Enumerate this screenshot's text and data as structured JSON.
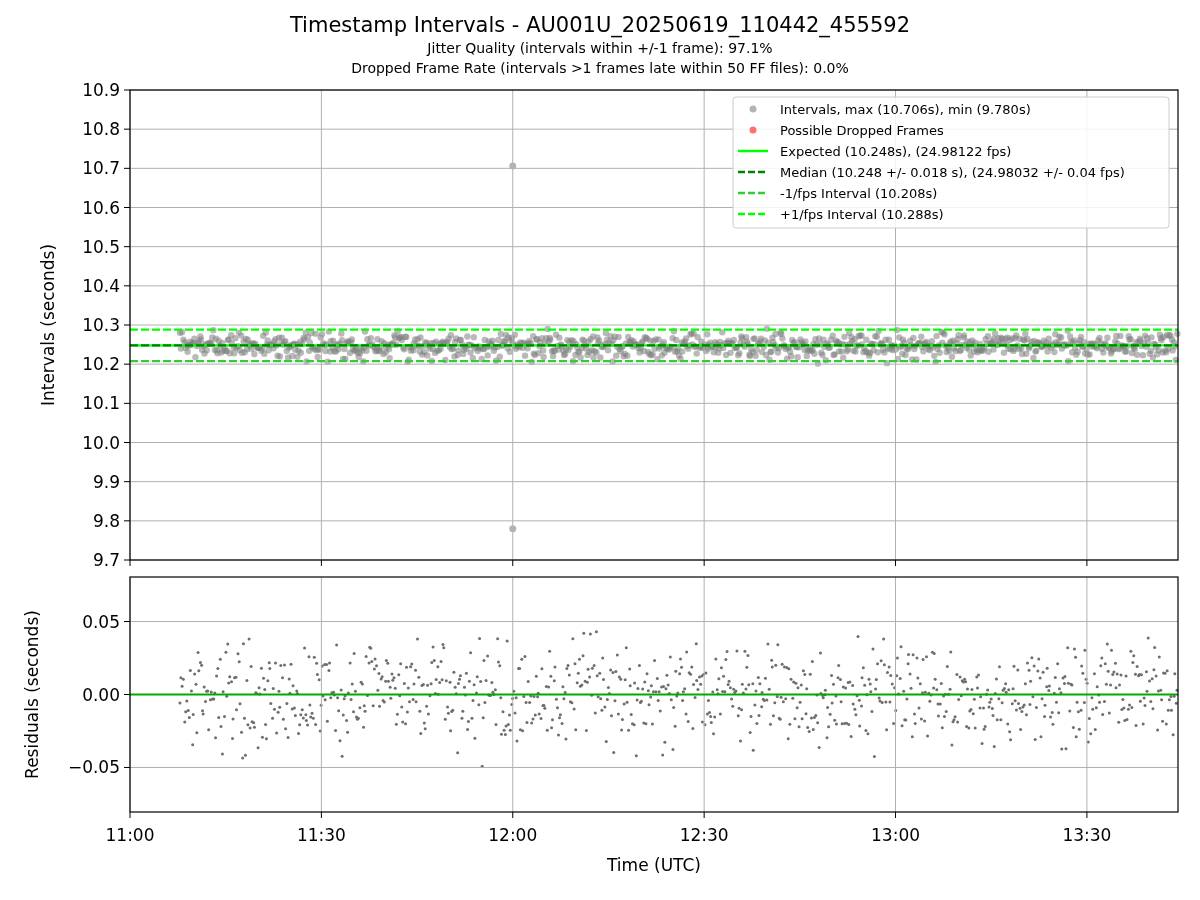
{
  "title": "Timestamp Intervals - AU001U_20250619_110442_455592",
  "subtitles": [
    "Jitter Quality (intervals within +/-1 frame): 97.1%",
    "Dropped Frame Rate (intervals >1 frames late within 50 FF files): 0.0%"
  ],
  "charts": [
    {
      "chart_data": {
        "type": "scatter",
        "ylabel": "Intervals (seconds)",
        "grid": true,
        "legend": "upper right",
        "x": [
          12,
          12
        ],
        "xlim": [
          11,
          13.738
        ],
        "ylim": [
          9.7,
          10.9
        ],
        "yticks": [
          {
            "value": 9.7,
            "label": "9.7"
          },
          {
            "value": 9.8,
            "label": "9.8"
          },
          {
            "value": 9.9,
            "label": "9.9"
          },
          {
            "value": 10.0,
            "label": "10.0"
          },
          {
            "value": 10.1,
            "label": "10.1"
          },
          {
            "value": 10.2,
            "label": "10.2"
          },
          {
            "value": 10.3,
            "label": "10.3"
          },
          {
            "value": 10.4,
            "label": "10.4"
          },
          {
            "value": 10.5,
            "label": "10.5"
          },
          {
            "value": 10.6,
            "label": "10.6"
          },
          {
            "value": 10.7,
            "label": "10.7"
          },
          {
            "value": 10.8,
            "label": "10.8"
          },
          {
            "value": 10.9,
            "label": "10.9"
          }
        ],
        "series": [
          {
            "name": "Intervals, max (10.706s), min (9.780s)",
            "color": "#b3b3b3",
            "values": [
              10.706,
              9.78
            ]
          },
          {
            "name": "Possible Dropped Frames",
            "color": "#ff7070",
            "values": [
              null,
              null
            ]
          }
        ],
        "ref_lines": [
          {
            "axis": "y",
            "value": 10.248,
            "label": "Expected (10.248s), (24.98122 fps)",
            "color": "#00ff00",
            "line_style": "solid"
          },
          {
            "axis": "y",
            "value": 10.248,
            "label": "Median (10.248 +/- 0.018 s), (24.98032 +/- 0.04 fps)",
            "color": "#008000",
            "line_style": "dashed"
          },
          {
            "axis": "y",
            "value": 10.208,
            "label": "-1/fps Interval (10.208s)",
            "color": "#32cd32",
            "line_style": "dashed"
          },
          {
            "axis": "y",
            "value": 10.288,
            "label": "+1/fps Interval (10.288s)",
            "color": "#00ff00",
            "line_style": "dashed"
          }
        ]
      }
    },
    {
      "chart_data": {
        "type": "scatter",
        "ylabel": "Residuals (seconds)",
        "xlabel": "Time (UTC)",
        "grid": true,
        "xlim": [
          11,
          13.738
        ],
        "ylim": [
          -0.0805,
          0.0805
        ],
        "xticks": [
          {
            "value": 11,
            "label": "11:00"
          },
          {
            "value": 11.5,
            "label": "11:30"
          },
          {
            "value": 12,
            "label": "12:00"
          },
          {
            "value": 12.5,
            "label": "12:30"
          },
          {
            "value": 13,
            "label": "13:00"
          },
          {
            "value": 13.5,
            "label": "13:30"
          }
        ],
        "yticks": [
          {
            "value": -0.05,
            "label": "−0.05"
          },
          {
            "value": 0,
            "label": "0.00"
          },
          {
            "value": 0.05,
            "label": "0.05"
          }
        ],
        "ref_lines": [
          {
            "axis": "y",
            "value": 0,
            "color": "#00aa00",
            "line_style": "solid"
          }
        ]
      }
    }
  ]
}
